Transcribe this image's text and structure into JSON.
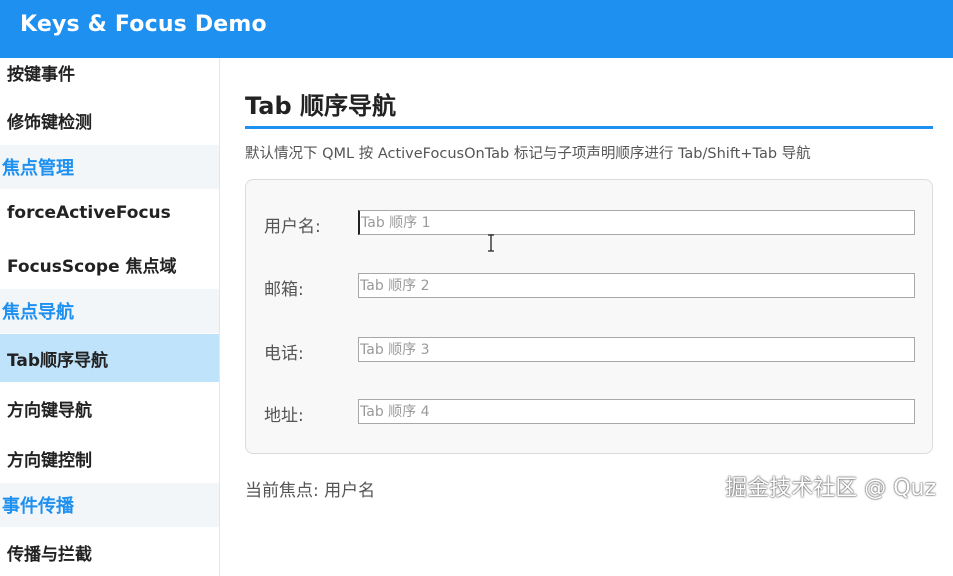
{
  "app": {
    "title": "Keys & Focus Demo"
  },
  "sidebar": {
    "items": [
      {
        "kind": "item",
        "label": "按键事件"
      },
      {
        "kind": "item",
        "label": "修饰键检测"
      },
      {
        "kind": "group",
        "label": "焦点管理"
      },
      {
        "kind": "item",
        "label": "forceActiveFocus"
      },
      {
        "kind": "item",
        "label": "FocusScope 焦点域"
      },
      {
        "kind": "group",
        "label": "焦点导航"
      },
      {
        "kind": "item",
        "label": "Tab顺序导航",
        "selected": true
      },
      {
        "kind": "item",
        "label": "方向键导航"
      },
      {
        "kind": "item",
        "label": "方向键控制"
      },
      {
        "kind": "group",
        "label": "事件传播"
      },
      {
        "kind": "item",
        "label": "传播与拦截"
      }
    ]
  },
  "main": {
    "title": "Tab 顺序导航",
    "description": "默认情况下 QML 按 ActiveFocusOnTab 标记与子项声明顺序进行 Tab/Shift+Tab 导航",
    "form": {
      "fields": [
        {
          "label": "用户名:",
          "value": "",
          "placeholder": "Tab 顺序 1",
          "focused": true
        },
        {
          "label": "邮箱:",
          "value": "",
          "placeholder": "Tab 顺序 2"
        },
        {
          "label": "电话:",
          "value": "",
          "placeholder": "Tab 顺序 3"
        },
        {
          "label": "地址:",
          "value": "",
          "placeholder": "Tab 顺序 4"
        }
      ]
    },
    "status": "当前焦点: 用户名"
  },
  "watermark": "掘金技术社区 @ Quz",
  "colors": {
    "accent": "#1e90f0",
    "selected_bg": "#bfe3fb",
    "group_bg": "#f3f6f9"
  },
  "icons": {
    "text_cursor": "i-beam-cursor-icon"
  }
}
